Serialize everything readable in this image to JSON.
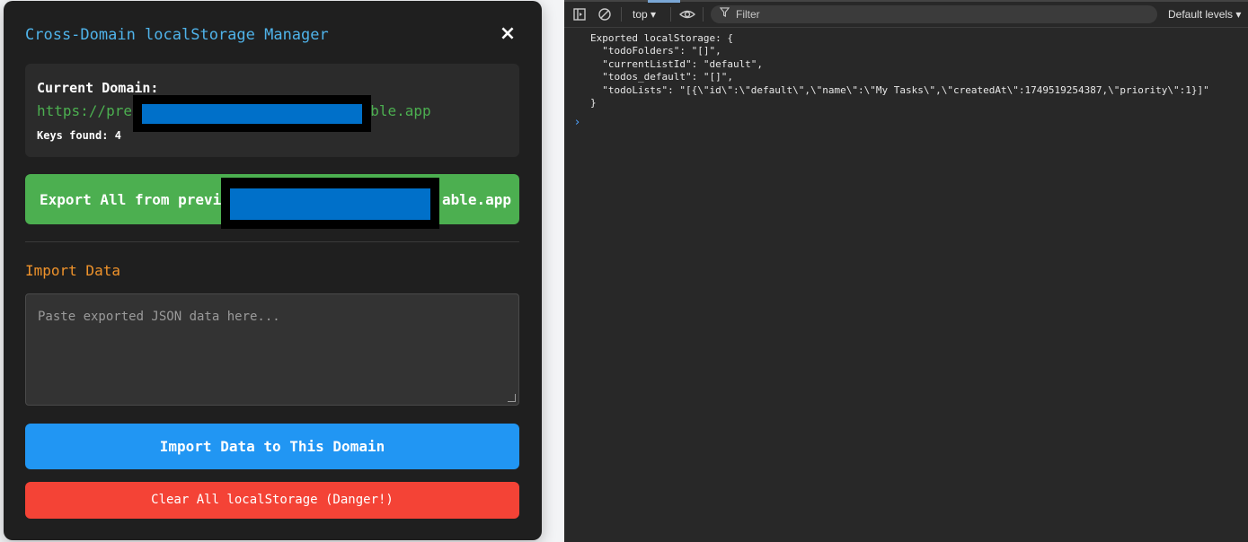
{
  "modal": {
    "title": "Cross-Domain localStorage Manager",
    "close_icon": "×",
    "domain_label": "Current Domain:",
    "domain_url_prefix": "https://pre",
    "domain_url_suffix": "able.app",
    "keys_found": "Keys found: 4",
    "export_label_prefix": "Export All from previ",
    "export_label_suffix": "able.app",
    "import_title": "Import Data",
    "import_placeholder": "Paste exported JSON data here...",
    "import_button": "Import Data to This Domain",
    "clear_button": "Clear All localStorage (Danger!)",
    "colors": {
      "title": "#4fb3ea",
      "url": "#4caf50",
      "export_bg": "#4caf50",
      "import_title": "#f0932b",
      "import_bg": "#2196f3",
      "clear_bg": "#f44336",
      "redaction": "#0070c9"
    }
  },
  "devtools": {
    "icons": [
      "sidebar-toggle-icon",
      "clear-console-icon",
      "eye-icon",
      "filter-icon"
    ],
    "context": "top ▾",
    "filter_placeholder": "Filter",
    "levels": "Default levels ▾",
    "console_lines": [
      "Exported localStorage: {",
      "  \"todoFolders\": \"[]\",",
      "  \"currentListId\": \"default\",",
      "  \"todos_default\": \"[]\",",
      "  \"todoLists\": \"[{\\\"id\\\":\\\"default\\\",\\\"name\\\":\\\"My Tasks\\\",\\\"createdAt\\\":1749519254387,\\\"priority\\\":1}]\"",
      "}"
    ],
    "prompt": "›"
  }
}
